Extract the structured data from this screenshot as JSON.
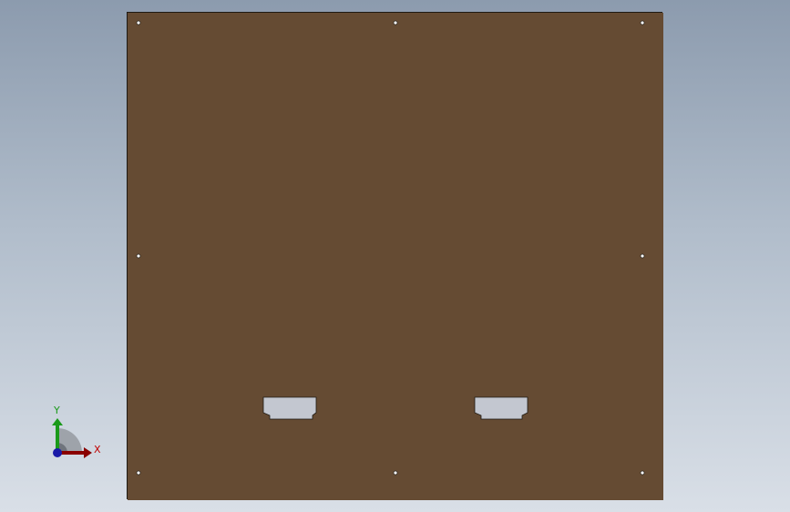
{
  "viewport": {
    "background_top": "#8c9bae",
    "background_bottom": "#d9dfe7"
  },
  "part": {
    "face_color": "#654b33",
    "edge_color": "#1f1a14",
    "mounting_holes": 8,
    "rectangular_cutouts": 2
  },
  "triad": {
    "x_label": "X",
    "y_label": "Y",
    "x_color": "#c00000",
    "y_color": "#1a9a1a",
    "z_color": "#1a1aa8"
  }
}
